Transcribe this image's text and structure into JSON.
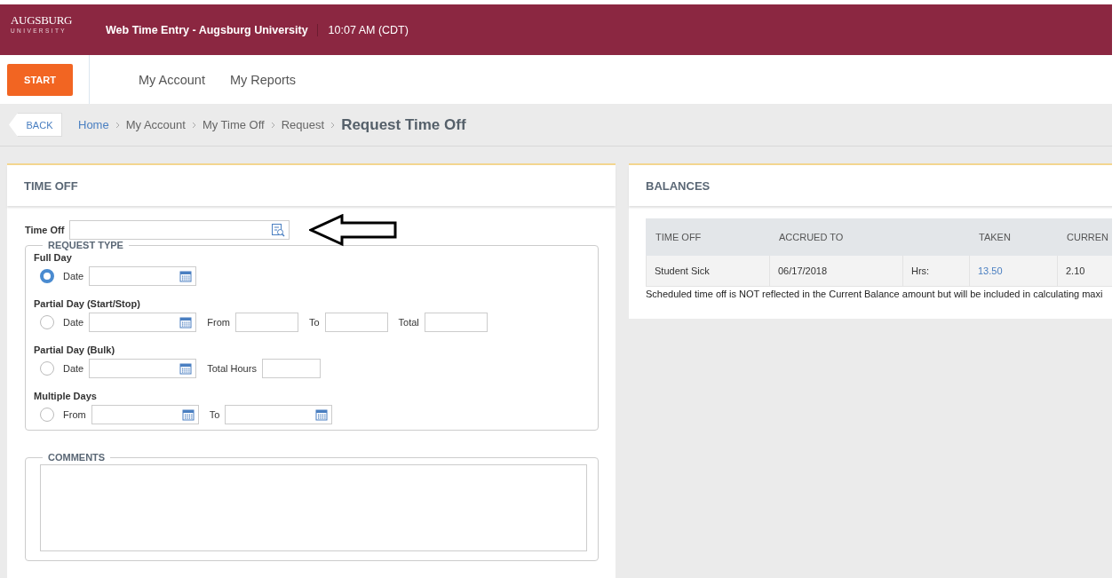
{
  "header": {
    "logo_top": "AUGSBURG",
    "logo_bottom": "UNIVERSITY",
    "title": "Web Time Entry - Augsburg University",
    "time": "10:07 AM (CDT)"
  },
  "nav": {
    "start": "START",
    "links": [
      "My Account",
      "My Reports"
    ]
  },
  "breadcrumb": {
    "back": "BACK",
    "items": [
      "Home",
      "My Account",
      "My Time Off",
      "Request"
    ],
    "current": "Request Time Off"
  },
  "time_off_panel": {
    "title": "TIME OFF",
    "time_off_label": "Time Off",
    "request_type": {
      "legend": "REQUEST TYPE",
      "options": [
        {
          "title": "Full Day",
          "selected": true,
          "fields": [
            {
              "kind": "date",
              "label": "Date"
            }
          ]
        },
        {
          "title": "Partial Day (Start/Stop)",
          "selected": false,
          "fields": [
            {
              "kind": "date",
              "label": "Date"
            },
            {
              "kind": "text",
              "label": "From"
            },
            {
              "kind": "text",
              "label": "To"
            },
            {
              "kind": "text",
              "label": "Total"
            }
          ]
        },
        {
          "title": "Partial Day (Bulk)",
          "selected": false,
          "fields": [
            {
              "kind": "date",
              "label": "Date"
            },
            {
              "kind": "text",
              "label": "Total Hours"
            }
          ]
        },
        {
          "title": "Multiple Days",
          "selected": false,
          "fields": [
            {
              "kind": "date",
              "label": "From"
            },
            {
              "kind": "date",
              "label": "To"
            }
          ]
        }
      ]
    },
    "comments_legend": "COMMENTS"
  },
  "balances_panel": {
    "title": "BALANCES",
    "columns": [
      {
        "label": "TIME OFF"
      },
      {
        "label": "ACCRUED TO"
      },
      {},
      {
        "label": "TAKEN"
      },
      {
        "label": "CURREN"
      }
    ],
    "rows": [
      {
        "cells": [
          {
            "kind": "text",
            "text": "Student Sick"
          },
          {
            "kind": "text",
            "text": "06/17/2018"
          },
          {
            "kind": "text",
            "text": "Hrs:"
          },
          {
            "kind": "link",
            "text": "13.50"
          },
          {
            "kind": "text",
            "text": "2.10"
          }
        ]
      }
    ],
    "note": "Scheduled time off is NOT reflected in the Current Balance amount but will be included in calculating maxi"
  }
}
